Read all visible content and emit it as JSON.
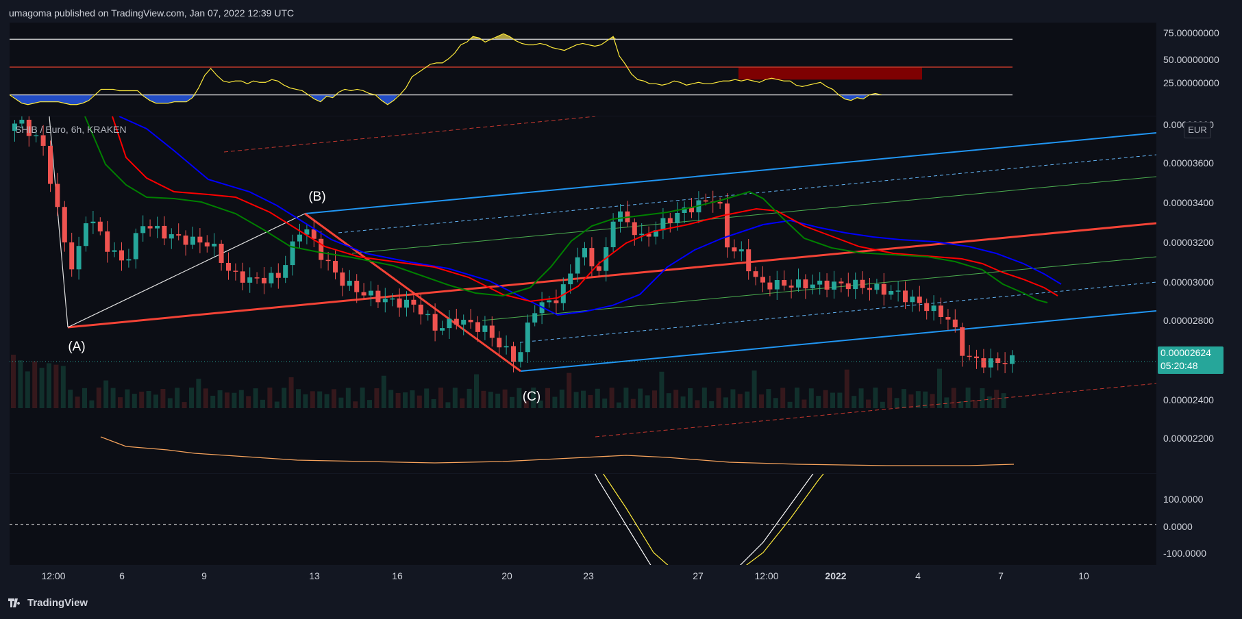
{
  "header": {
    "published": "umagoma published on TradingView.com, Jan 07, 2022 12:39 UTC"
  },
  "legend": {
    "symbol": "SHIB / Euro, 6h, KRAKEN"
  },
  "currency_box": "EUR",
  "last_price": {
    "value": "0.00002624",
    "countdown": "05:20:48"
  },
  "footer": {
    "brand": "TradingView"
  },
  "colors": {
    "up": "#26a69a",
    "down": "#ef5350",
    "pitchfork_red": "#f44336",
    "pitchfork_blue": "#2196f3",
    "ema_green": "#008000",
    "ema_red": "#ff0000",
    "ema_blue": "#0000ff",
    "rsi": "#ffeb3b",
    "cci": "#ffffff"
  },
  "chart_data": [
    {
      "type": "line",
      "name": "RSI panel",
      "y_ticks": [
        "75.00000000",
        "50.00000000",
        "25.00000000"
      ],
      "ylim": [
        15,
        82
      ],
      "levels": [
        70,
        50,
        30
      ]
    },
    {
      "type": "candlestick",
      "name": "price panel",
      "y_ticks": [
        "0.00003800",
        "0.00003600",
        "0.00003400",
        "0.00003200",
        "0.00003000",
        "0.00002800",
        "0.00002600",
        "0.00002400",
        "0.00002200"
      ],
      "ylim": [
        2.08e-05,
        3.82e-05
      ],
      "x_ticks": [
        "12:00",
        "6",
        "9",
        "13",
        "16",
        "20",
        "23",
        "27",
        "12:00",
        "2022",
        "4",
        "7",
        "10"
      ],
      "annotations": [
        "(A)",
        "(B)",
        "(C)"
      ]
    },
    {
      "type": "line",
      "name": "CCI panel",
      "y_ticks": [
        "100.0000",
        "0.0000",
        "-100.0000"
      ],
      "ylim": [
        -140,
        175
      ]
    }
  ]
}
